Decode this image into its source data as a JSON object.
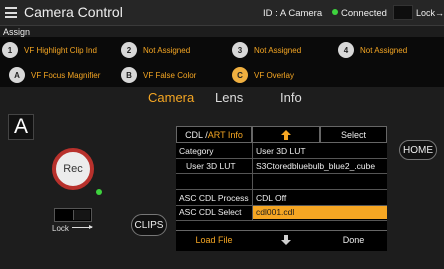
{
  "header": {
    "title": "Camera Control",
    "camera_id": "ID : A Camera",
    "connection_status": "Connected",
    "lock_label": "Lock"
  },
  "assign": {
    "section_label": "Assign",
    "row1": [
      {
        "key": "1",
        "label": "VF Highlight Clip Ind"
      },
      {
        "key": "2",
        "label": "Not Assigned"
      },
      {
        "key": "3",
        "label": "Not Assigned"
      },
      {
        "key": "4",
        "label": "Not Assigned"
      }
    ],
    "row2": [
      {
        "key": "A",
        "label": "VF Focus Magnifier"
      },
      {
        "key": "B",
        "label": "VF False Color"
      },
      {
        "key": "C",
        "label": "VF Overlay"
      }
    ]
  },
  "tabs": [
    {
      "label": "Camera",
      "active": true
    },
    {
      "label": "Lens",
      "active": false
    },
    {
      "label": "Info",
      "active": false
    }
  ],
  "camera_badge": "A",
  "controls": {
    "rec_label": "Rec",
    "lock_label": "Lock",
    "clips_label": "CLIPS",
    "home_label": "HOME"
  },
  "panel": {
    "header_prefix": "CDL / ",
    "header_accent": "ART Info",
    "select_label": "Select",
    "rows": [
      {
        "label": "Category",
        "value": "User 3D LUT"
      },
      {
        "label": "User 3D LUT",
        "value": "S3Ctoredbluebulb_blue2_.cube"
      },
      {
        "label": "",
        "value": ""
      },
      {
        "label": "ASC CDL Process",
        "value": "CDL Off"
      },
      {
        "label": "ASC CDL Select",
        "value": "cdl001.cdl"
      }
    ],
    "load_file_label": "Load File",
    "done_label": "Done"
  },
  "colors": {
    "accent": "#f5a623",
    "rec_ring": "#b8312c",
    "status_green": "#3ed33e"
  }
}
